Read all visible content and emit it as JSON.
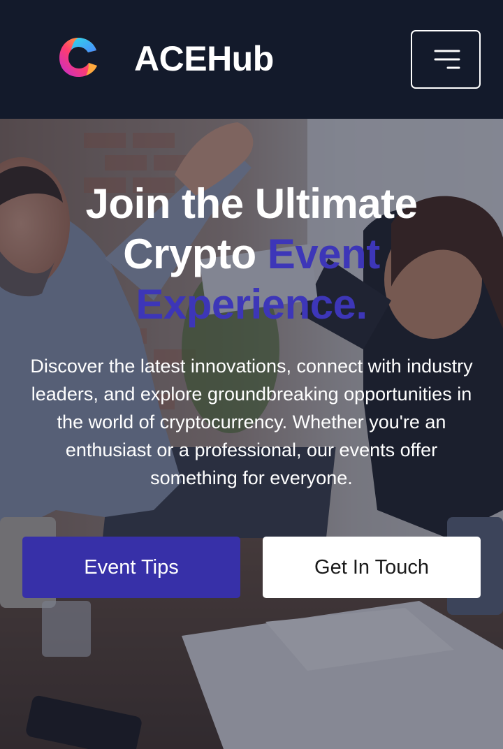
{
  "header": {
    "brand": "ACEHub",
    "logo_icon": "ace-logo-icon",
    "menu_icon": "menu-icon"
  },
  "hero": {
    "headline_part1": "Join the Ultimate Crypto ",
    "headline_accent": "Event Experience.",
    "description": "Discover the latest innovations, connect with industry leaders, and explore groundbreaking opportunities in the world of cryptocurrency. Whether you're an enthusiast or a professional, our events offer something for everyone.",
    "primary_button": "Event Tips",
    "secondary_button": "Get In Touch"
  },
  "colors": {
    "header_bg": "#131a2b",
    "accent": "#3730a8",
    "accent_text": "#3d36b8",
    "button_light": "#ffffff"
  }
}
